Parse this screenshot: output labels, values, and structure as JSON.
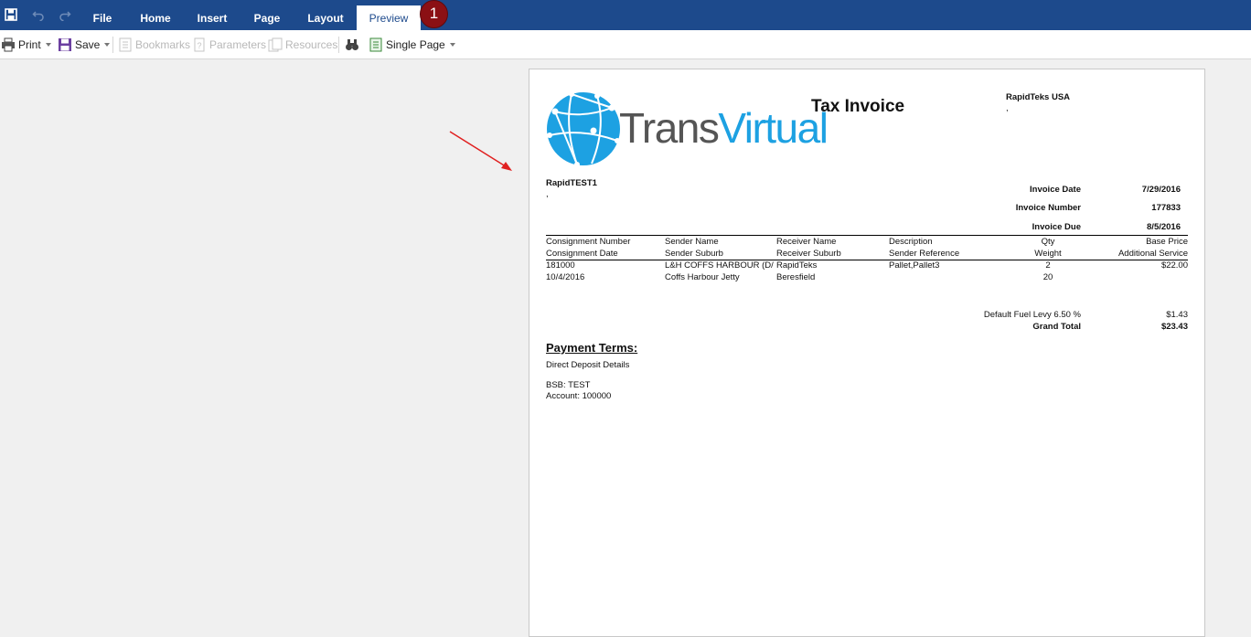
{
  "ribbon": {
    "tabs": [
      "File",
      "Home",
      "Insert",
      "Page",
      "Layout",
      "Preview"
    ],
    "active_tab": "Preview",
    "badge": "1"
  },
  "toolbar": {
    "print": "Print",
    "save": "Save",
    "bookmarks": "Bookmarks",
    "parameters": "Parameters",
    "resources": "Resources",
    "view_mode": "Single Page"
  },
  "invoice": {
    "logo_text_a": "Trans",
    "logo_text_b": "Virtual",
    "title": "Tax Invoice",
    "company": "RapidTeks USA",
    "company_line2": ",",
    "customer": "RapidTEST1",
    "customer_line2": ",",
    "meta": [
      {
        "label": "Invoice Date",
        "value": "7/29/2016"
      },
      {
        "label": "Invoice Number",
        "value": "177833"
      },
      {
        "label": "Invoice Due",
        "value": "8/5/2016"
      }
    ],
    "headers_row1": [
      "Consignment Number",
      "Sender Name",
      "Receiver Name",
      "Description",
      "Qty",
      "Base Price"
    ],
    "headers_row2": [
      "Consignment Date",
      "Sender Suburb",
      "Receiver Suburb",
      "Sender Reference",
      "Weight",
      "Additional Service"
    ],
    "row1": [
      "181000",
      "L&H COFFS HARBOUR (D/",
      "RapidTeks",
      "Pallet,Pallet3",
      "2",
      "$22.00"
    ],
    "row2": [
      "10/4/2016",
      "Coffs Harbour Jetty",
      "Beresfield",
      "",
      "20",
      ""
    ],
    "fuel_label": "Default Fuel Levy 6.50 %",
    "fuel_value": "$1.43",
    "total_label": "Grand Total",
    "total_value": "$23.43",
    "payment_heading": "Payment Terms:",
    "payment_line1": "Direct Deposit Details",
    "bsb": "BSB: TEST",
    "account": "Account: 100000"
  },
  "colors": {
    "ribbon": "#1d4a8c",
    "badge": "#8b1014",
    "logo_blue": "#1da1e2",
    "logo_gray": "#555555",
    "arrow": "#e02020"
  }
}
